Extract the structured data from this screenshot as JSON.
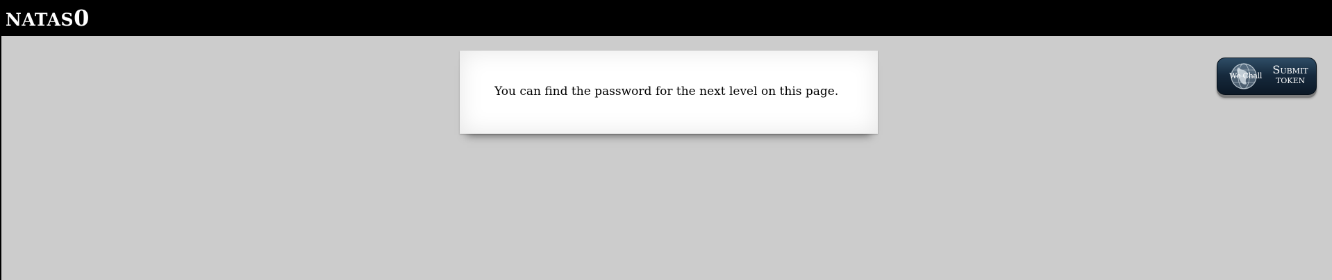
{
  "header": {
    "title_name": "NATAS",
    "title_number": "0"
  },
  "content": {
    "message": "You can find the password for the next level on this page."
  },
  "wechall": {
    "logo_text": "We Chall",
    "line1": "Submit",
    "line2": "token"
  }
}
